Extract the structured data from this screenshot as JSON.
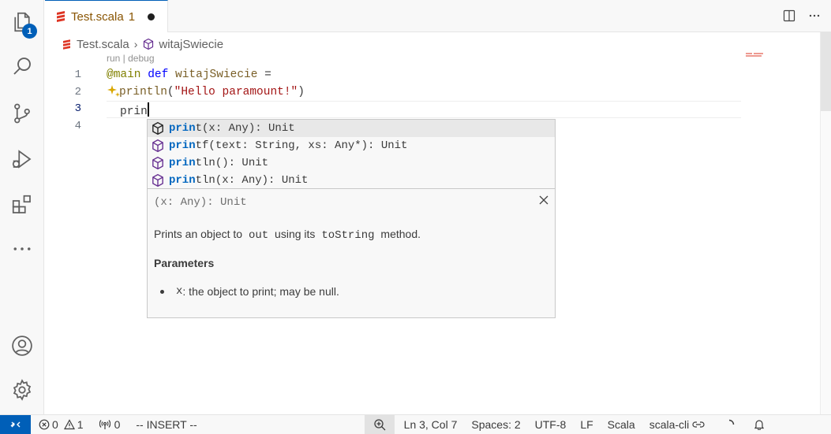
{
  "activity_bar": {
    "explorer_badge": "1"
  },
  "tab": {
    "title": "Test.scala",
    "problems": "1"
  },
  "breadcrumb": {
    "file": "Test.scala",
    "symbol": "witajSwiecie"
  },
  "editor": {
    "codelens": "run | debug",
    "line_numbers": [
      "1",
      "2",
      "3",
      "4"
    ],
    "line1": {
      "annotation": "@main",
      "keyword": "def",
      "name": "witajSwiecie",
      "rest": " ="
    },
    "line2": {
      "fn": "println",
      "open": "(",
      "string": "\"Hello paramount!\"",
      "close": ")"
    },
    "line3": {
      "typed": "prin"
    }
  },
  "suggest": {
    "match": "prin",
    "items": [
      {
        "rest": "t(x: Any): Unit",
        "selected": true
      },
      {
        "rest": "tf(text: String, xs: Any*): Unit",
        "selected": false
      },
      {
        "rest": "tln(): Unit",
        "selected": false
      },
      {
        "rest": "tln(x: Any): Unit",
        "selected": false
      }
    ]
  },
  "details": {
    "signature": "(x: Any): Unit",
    "desc_pre": "Prints an object to ",
    "desc_code1": "out",
    "desc_mid": " using its ",
    "desc_code2": "toString",
    "desc_post": " method.",
    "params_heading": "Parameters",
    "param_name": "x",
    "param_desc": " : the object to print; may be null."
  },
  "status": {
    "errors": "0",
    "warnings": "1",
    "ports": "0",
    "mode": "-- INSERT --",
    "position": "Ln 3, Col 7",
    "spaces": "Spaces: 2",
    "encoding": "UTF-8",
    "eol": "LF",
    "language": "Scala",
    "build": "scala-cli"
  },
  "colors": {
    "accent": "#005fb8",
    "match": "#0066bf",
    "scala_red": "#de3423"
  }
}
